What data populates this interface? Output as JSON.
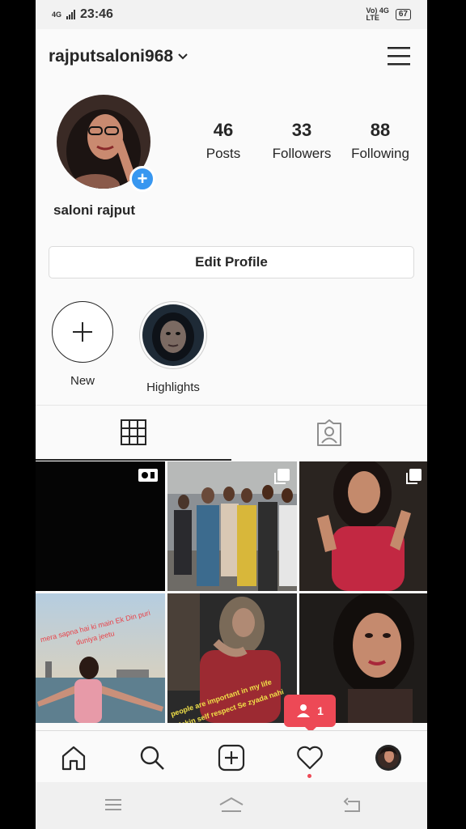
{
  "status": {
    "network": "4G",
    "time": "23:46",
    "volte": "Vo) 4G",
    "lte": "LTE",
    "battery": "67"
  },
  "header": {
    "username": "rajputsaloni968",
    "menu_icon": "hamburger-menu-icon"
  },
  "profile": {
    "full_name": "saloni rajput",
    "stats": [
      {
        "value": "46",
        "label": "Posts"
      },
      {
        "value": "33",
        "label": "Followers"
      },
      {
        "value": "88",
        "label": "Following"
      }
    ],
    "edit_label": "Edit Profile"
  },
  "highlights": [
    {
      "label": "New",
      "icon": "plus-icon"
    },
    {
      "label": "Highlights",
      "icon": "highlight-cover"
    }
  ],
  "tabs": [
    {
      "name": "grid",
      "icon": "grid-icon",
      "active": true
    },
    {
      "name": "tagged",
      "icon": "tagged-person-icon",
      "active": false
    }
  ],
  "posts": [
    {
      "type": "video"
    },
    {
      "type": "multiple"
    },
    {
      "type": "multiple"
    },
    {
      "type": "photo",
      "caption": "mera sapna hai ki main Ek Din puri duniya jeetu"
    },
    {
      "type": "photo",
      "caption": "people are important in my life lekin self respect Se zyada nahi"
    },
    {
      "type": "photo"
    }
  ],
  "notification": {
    "count": "1",
    "icon": "follower-person-icon"
  },
  "nav": [
    "home-icon",
    "search-icon",
    "add-post-icon",
    "activity-heart-icon",
    "profile-avatar"
  ],
  "colors": {
    "accent_blue": "#3897f0",
    "notify_red": "#ed4956"
  }
}
